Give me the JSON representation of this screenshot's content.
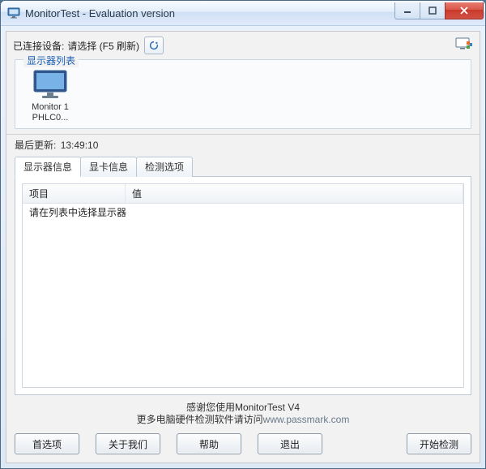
{
  "window": {
    "title": "MonitorTest - Evaluation version"
  },
  "topbar": {
    "connected_label": "已连接设备:",
    "select_hint": "请选择 (F5 刷新)"
  },
  "monitor_list": {
    "legend": "显示器列表",
    "items": [
      {
        "line1": "Monitor 1",
        "line2": "PHLC0..."
      }
    ]
  },
  "last_update": {
    "label": "最后更新:",
    "time": "13:49:10"
  },
  "tabs": [
    {
      "label": "显示器信息",
      "active": true
    },
    {
      "label": "显卡信息",
      "active": false
    },
    {
      "label": "检测选项",
      "active": false
    }
  ],
  "info_table": {
    "columns": {
      "name": "项目",
      "value": "值"
    },
    "empty_message": "请在列表中选择显示器"
  },
  "footer": {
    "thanks": "感谢您使用MonitorTest V4",
    "more_prefix": "更多电脑硬件检测软件请访问",
    "link": "www.passmark.com"
  },
  "buttons": {
    "prefs": "首选项",
    "about": "关于我们",
    "help": "帮助",
    "exit": "退出",
    "start": "开始检测"
  }
}
